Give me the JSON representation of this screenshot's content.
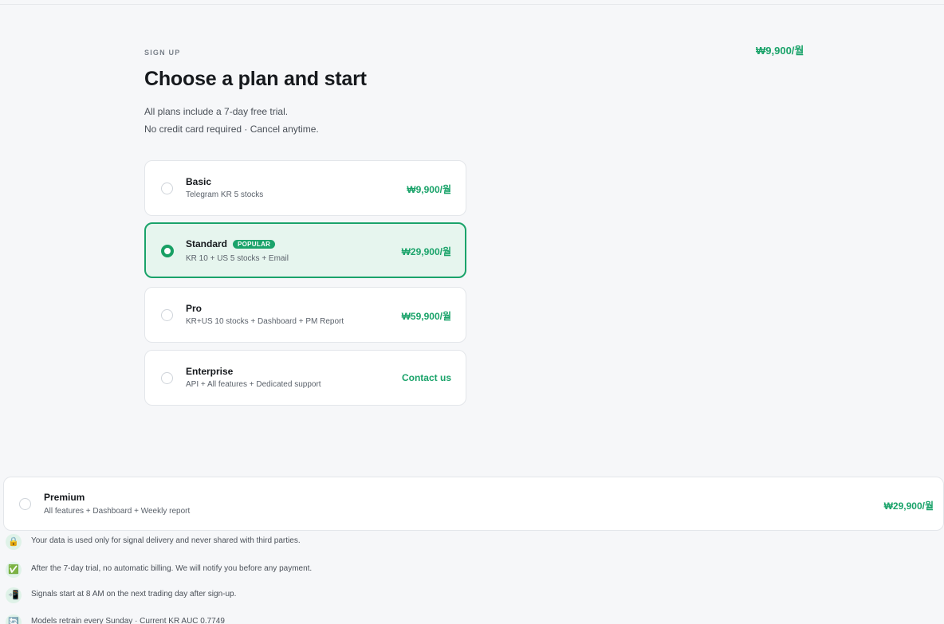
{
  "header": {
    "eyebrow": "SIGN UP",
    "title": "Choose a plan and start",
    "subtitle_line1": "All plans include a 7-day free trial.",
    "subtitle_line2": "No credit card required · Cancel anytime.",
    "summary_price": "₩9,900/월"
  },
  "plans": [
    {
      "name": "Basic",
      "description": "Telegram KR 5 stocks",
      "price": "₩9,900/월",
      "selected": false
    },
    {
      "name": "Standard",
      "badge": "POPULAR",
      "description": "KR 10 + US 5 stocks + Email",
      "price": "₩29,900/월",
      "selected": true
    },
    {
      "name": "Pro",
      "description": "KR+US 10 stocks + Dashboard + PM Report",
      "price": "₩59,900/월",
      "selected": false
    },
    {
      "name": "Enterprise",
      "description": "API + All features + Dedicated support",
      "price": "Contact us",
      "selected": false
    }
  ],
  "premium_plan": {
    "name": "Premium",
    "description": "All features + Dashboard + Weekly report",
    "price": "₩29,900/월",
    "selected": false
  },
  "notes": [
    {
      "icon": "lock-icon",
      "glyph": "🔒",
      "text": "Your data is used only for signal delivery and never shared with third parties."
    },
    {
      "icon": "check-icon",
      "glyph": "✅",
      "text": "After the 7-day trial, no automatic billing. We will notify you before any payment."
    },
    {
      "icon": "phone-icon",
      "glyph": "📲",
      "text": "Signals start at 8 AM on the next trading day after sign-up."
    },
    {
      "icon": "refresh-icon",
      "glyph": "🔄",
      "text": "Models retrain every Sunday · Current KR AUC 0.7749"
    }
  ],
  "colors": {
    "accent": "#1aa36a",
    "selected_bg": "#e6f5ee",
    "page_bg": "#f6f7f9"
  }
}
